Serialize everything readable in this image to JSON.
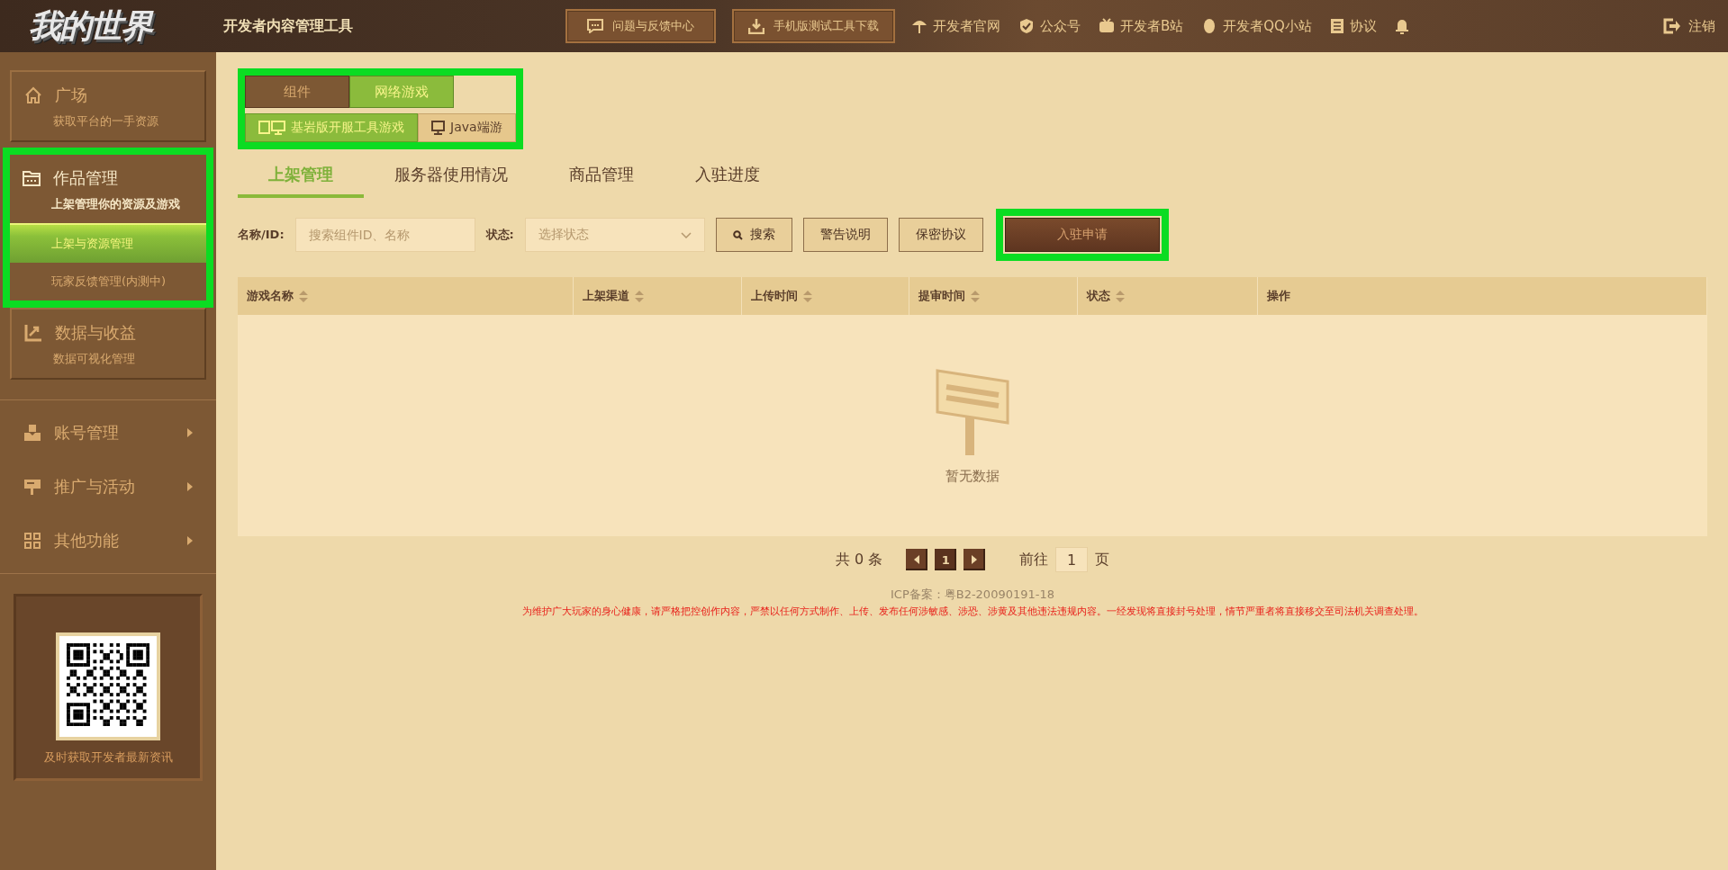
{
  "header": {
    "logo_text": "我的世界",
    "title": "开发者内容管理工具",
    "buttons": [
      {
        "label": "问题与反馈中心"
      },
      {
        "label": "手机版测试工具下载"
      }
    ],
    "links": [
      {
        "label": "开发者官网"
      },
      {
        "label": "公众号"
      },
      {
        "label": "开发者B站"
      },
      {
        "label": "开发者QQ小站"
      },
      {
        "label": "协议"
      }
    ],
    "logout": "注销"
  },
  "sidebar": {
    "cards": [
      {
        "title": "广场",
        "subtitle": "获取平台的一手资源",
        "selected": false,
        "highlighted": false
      },
      {
        "title": "作品管理",
        "subtitle": "上架管理你的资源及游戏",
        "selected": true,
        "highlighted": true,
        "children": [
          {
            "label": "上架与资源管理",
            "selected": true
          },
          {
            "label": "玩家反馈管理(内测中)",
            "selected": false
          }
        ]
      },
      {
        "title": "数据与收益",
        "subtitle": "数据可视化管理",
        "selected": false,
        "highlighted": false
      }
    ],
    "menus": [
      {
        "label": "账号管理"
      },
      {
        "label": "推广与活动"
      },
      {
        "label": "其他功能"
      }
    ],
    "qr_caption": "及时获取开发者最新资讯"
  },
  "type_tabs": {
    "highlighted": true,
    "category_tabs": [
      {
        "label": "组件",
        "selected": false
      },
      {
        "label": "网络游戏",
        "selected": true
      }
    ],
    "mode_tabs": [
      {
        "label": "基岩版开服工具游戏",
        "selected": true
      },
      {
        "label": "Java端游",
        "selected": false
      }
    ]
  },
  "page_tabs": [
    {
      "label": "上架管理",
      "selected": true
    },
    {
      "label": "服务器使用情况",
      "selected": false
    },
    {
      "label": "商品管理",
      "selected": false
    },
    {
      "label": "入驻进度",
      "selected": false
    }
  ],
  "filters": {
    "name_label": "名称/ID:",
    "name_placeholder": "搜索组件ID、名称",
    "status_label": "状态:",
    "status_placeholder": "选择状态",
    "buttons": [
      {
        "label": "搜索",
        "kind": "search",
        "highlighted": false
      },
      {
        "label": "警告说明",
        "kind": "plain",
        "highlighted": false
      },
      {
        "label": "保密协议",
        "kind": "plain",
        "highlighted": false
      },
      {
        "label": "入驻申请",
        "kind": "primary",
        "highlighted": true
      }
    ]
  },
  "table": {
    "columns": [
      {
        "label": "游戏名称",
        "sortable": true
      },
      {
        "label": "上架渠道",
        "sortable": true
      },
      {
        "label": "上传时间",
        "sortable": true
      },
      {
        "label": "提审时间",
        "sortable": true
      },
      {
        "label": "状态",
        "sortable": true
      },
      {
        "label": "操作",
        "sortable": false
      }
    ],
    "empty_text": "暂无数据"
  },
  "pagination": {
    "total": "共 0 条",
    "pages": [
      {
        "label": "1",
        "selected": true
      }
    ],
    "goto_label": "前往",
    "goto_value": "1",
    "page_suffix": "页"
  },
  "footer": {
    "icp": "ICP备案：粤B2-20090191-18",
    "notice": "为维护广大玩家的身心健康，请严格把控创作内容，严禁以任何方式制作、上传、发布任何涉敏感、涉恐、涉黄及其他违法违规内容。一经发现将直接封号处理，情节严重者将直接移交至司法机关调查处理。"
  }
}
